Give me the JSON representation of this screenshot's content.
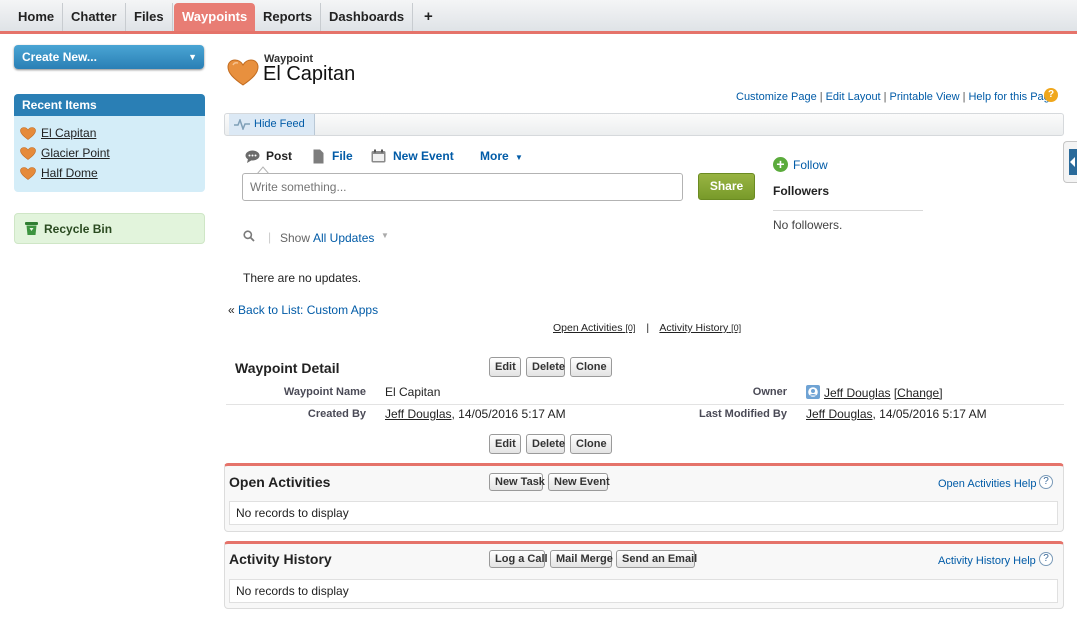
{
  "tabs": [
    {
      "label": "Home",
      "active": false
    },
    {
      "label": "Chatter",
      "active": false
    },
    {
      "label": "Files",
      "active": false
    },
    {
      "label": "Waypoints",
      "active": true
    },
    {
      "label": "Reports",
      "active": false
    },
    {
      "label": "Dashboards",
      "active": false
    },
    {
      "label": "+",
      "active": false
    }
  ],
  "sidebar": {
    "create_new": "Create New...",
    "recent_title": "Recent Items",
    "recent_items": [
      "El Capitan",
      "Glacier Point",
      "Half Dome"
    ],
    "recycle_bin": "Recycle Bin"
  },
  "header": {
    "record_type": "Waypoint",
    "record_name": "El Capitan",
    "links": [
      "Customize Page",
      "Edit Layout",
      "Printable View",
      "Help for this Page"
    ],
    "separator": "|",
    "help_icon": "?"
  },
  "feed": {
    "hide_feed": "Hide Feed",
    "publisher": [
      "Post",
      "File",
      "New Event",
      "More"
    ],
    "placeholder": "Write something...",
    "share": "Share",
    "follow": "Follow",
    "followers_title": "Followers",
    "no_followers": "No followers.",
    "show_label": "Show",
    "show_value": "All Updates",
    "no_updates": "There are no updates."
  },
  "nav": {
    "back_prefix": "«",
    "back_list": "Back to List: Custom Apps",
    "open_activities": "Open Activities",
    "open_activities_count": "[0]",
    "activity_history": "Activity History",
    "activity_history_count": "[0]",
    "separator": "|"
  },
  "detail": {
    "title": "Waypoint Detail",
    "buttons": [
      "Edit",
      "Delete",
      "Clone"
    ],
    "fields": {
      "waypoint_name_label": "Waypoint Name",
      "waypoint_name": "El Capitan",
      "owner_label": "Owner",
      "owner": "Jeff Douglas",
      "owner_change": "[Change]",
      "created_by_label": "Created By",
      "created_by_user": "Jeff Douglas",
      "created_by_date": ", 14/05/2016 5:17 AM",
      "modified_by_label": "Last Modified By",
      "modified_by_user": "Jeff Douglas",
      "modified_by_date": ", 14/05/2016 5:17 AM"
    }
  },
  "open_activities": {
    "title": "Open Activities",
    "buttons": [
      "New Task",
      "New Event"
    ],
    "help": "Open Activities Help",
    "empty": "No records to display"
  },
  "activity_history": {
    "title": "Activity History",
    "buttons": [
      "Log a Call",
      "Mail Merge",
      "Send an Email"
    ],
    "help": "Activity History Help",
    "empty": "No records to display"
  },
  "colors": {
    "accent": "#e5736a",
    "link": "#015ba7",
    "sidebar_blue": "#2a7fb5",
    "share_green": "#8aa83a"
  },
  "icons": {
    "record": "heart-icon",
    "recycle": "recycle-bin-icon",
    "search": "search-icon",
    "follow": "plus-circle-icon"
  }
}
